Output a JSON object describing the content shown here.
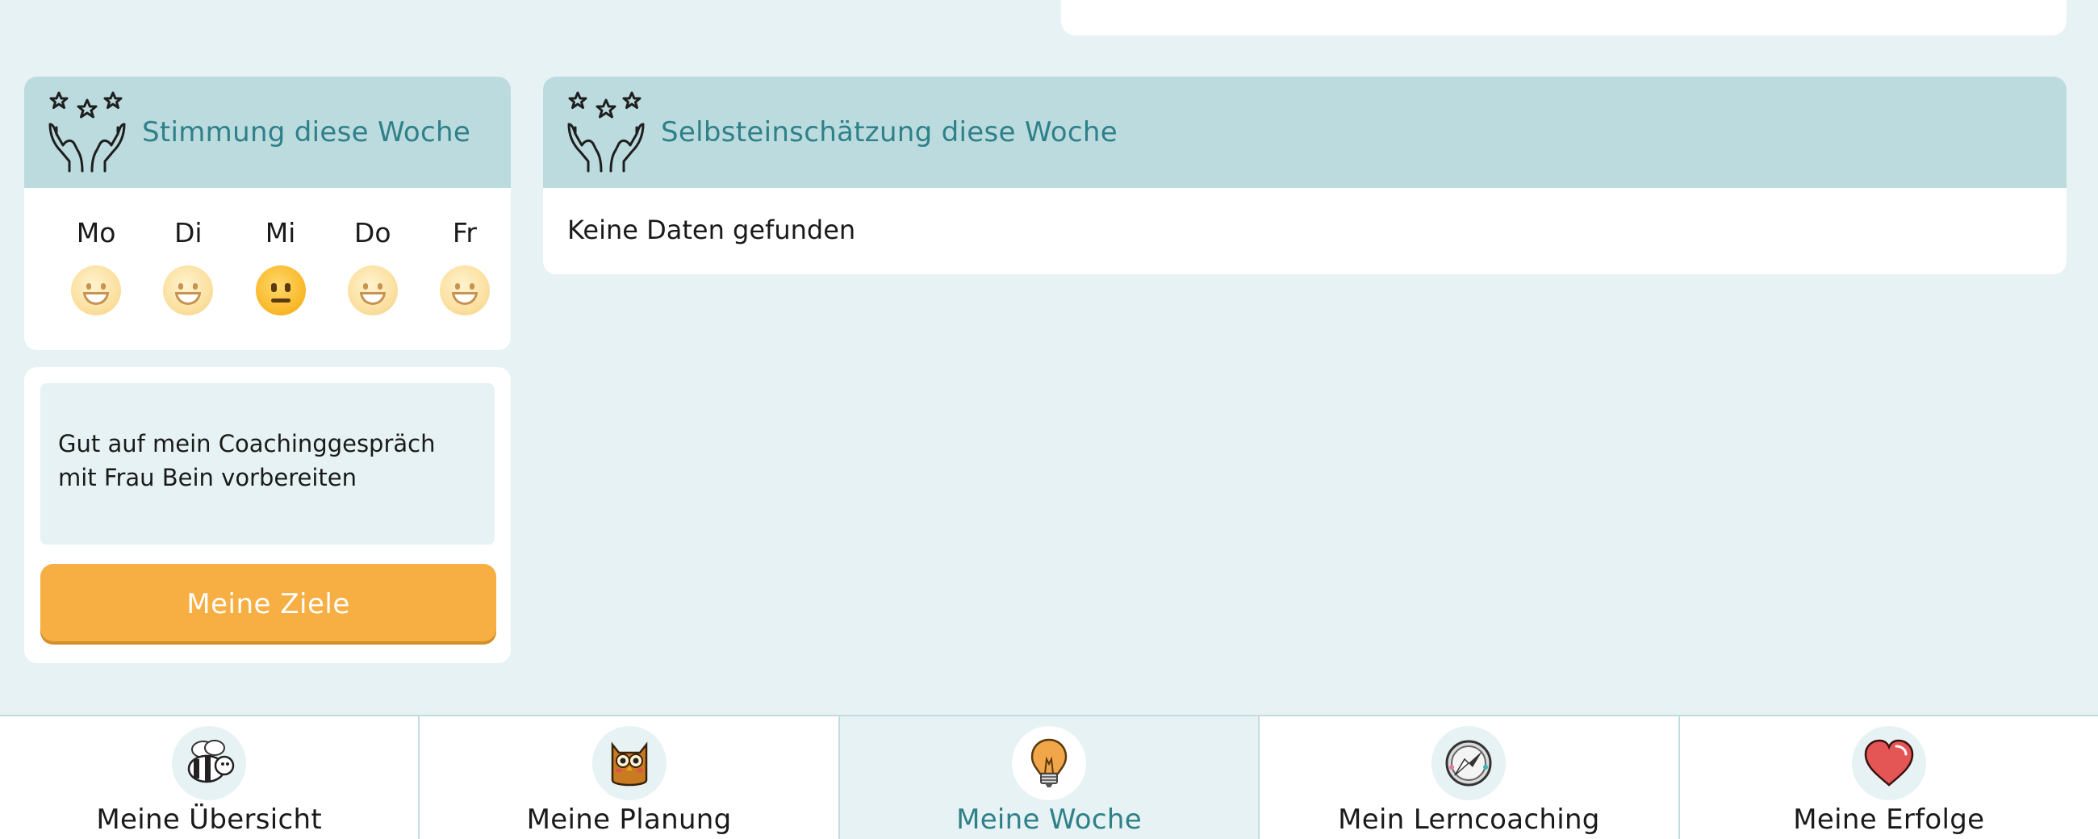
{
  "mood": {
    "title": "Stimmung diese Woche",
    "days": [
      {
        "label": "Mo",
        "mood": "happy-face-icon"
      },
      {
        "label": "Di",
        "mood": "happy-face-icon"
      },
      {
        "label": "Mi",
        "mood": "neutral-face-icon"
      },
      {
        "label": "Do",
        "mood": "happy-face-icon"
      },
      {
        "label": "Fr",
        "mood": "happy-face-icon"
      }
    ]
  },
  "self_assessment": {
    "title": "Selbsteinschätzung diese Woche",
    "empty_text": "Keine Daten gefunden"
  },
  "goals": {
    "goal_text": "Gut auf mein Coachinggespräch mit Frau Bein vorbereiten",
    "button_label": "Meine Ziele"
  },
  "nav": {
    "items": [
      {
        "label": "Meine Übersicht",
        "icon": "bee-icon"
      },
      {
        "label": "Meine Planung",
        "icon": "owl-icon"
      },
      {
        "label": "Meine Woche",
        "icon": "lightbulb-icon",
        "active": true
      },
      {
        "label": "Mein Lerncoaching",
        "icon": "compass-icon"
      },
      {
        "label": "Meine Erfolge",
        "icon": "heart-icon"
      }
    ]
  },
  "colors": {
    "background": "#e6f2f3",
    "header": "#bcdbdf",
    "accent": "#2e8089",
    "button": "#f7ae42"
  }
}
